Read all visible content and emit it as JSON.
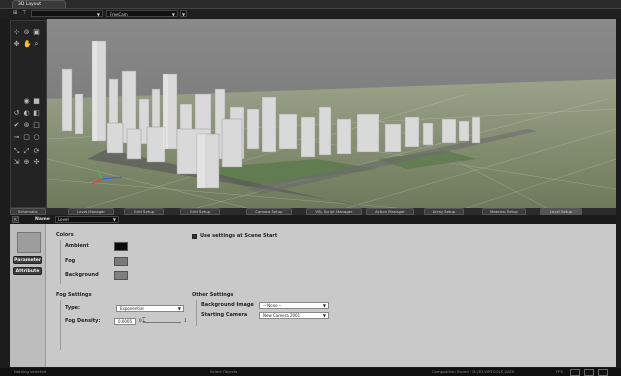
{
  "window": {
    "tab_label": "3D Layout"
  },
  "view_toolbar": {
    "camera_type": "",
    "camera_name": "FreeCam"
  },
  "panel_tabs": [
    "Schematic",
    "Level Manager",
    "Grid Setup",
    "Grid Setup",
    "Camera Setup",
    "VSL Script Manager",
    "Action Manager",
    "Array Setup",
    "Material Setup",
    "Level Setup"
  ],
  "name_row": {
    "name_label": "Name",
    "value": "Level"
  },
  "sidebar": {
    "parameter_label": "Parameter",
    "attribute_label": "Attribute"
  },
  "colors_section": {
    "title": "Colors",
    "items": [
      {
        "label": "Ambient",
        "color": "#0a0a0a"
      },
      {
        "label": "Fog",
        "color": "#7a7a7a"
      },
      {
        "label": "Background",
        "color": "#808080"
      }
    ]
  },
  "use_settings": {
    "label": "Use settings at Scene Start",
    "checked": true
  },
  "fog_settings": {
    "title": "Fog Settings",
    "type_label": "Type:",
    "type_value": "Exponential",
    "density_label": "Fog Density:",
    "density_value": "0.0005",
    "slider_min": "0",
    "slider_max": "1"
  },
  "other_settings": {
    "title": "Other Settings",
    "bg_image_label": "Background Image",
    "bg_image_value": "-- None --",
    "camera_label": "Starting Camera",
    "camera_value": "New Camera 2001"
  },
  "status_bar": {
    "left": "Nothing selected",
    "middle": "Select Objects",
    "right": "Composition Saved : D:\\3D VIRTOOLS DATA",
    "fps_label": "FPS"
  }
}
